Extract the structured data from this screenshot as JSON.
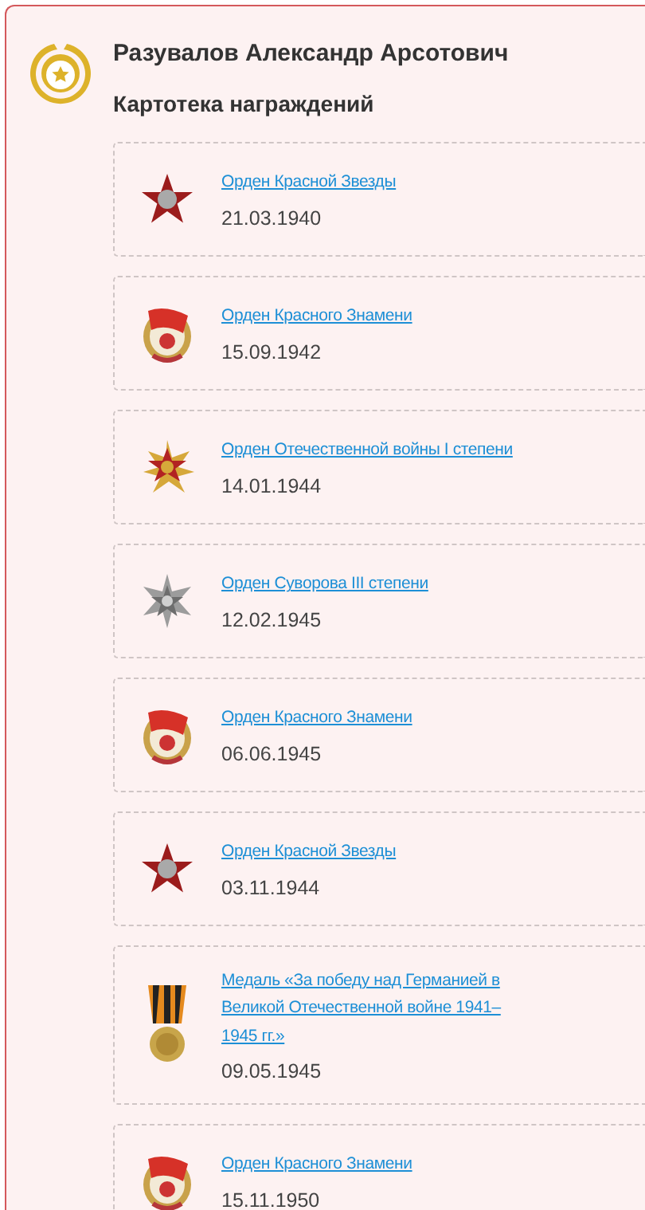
{
  "person": {
    "name": "Разувалов Александр Арсотович",
    "subtitle": "Картотека награждений"
  },
  "awards": [
    {
      "kind": "star",
      "title": "Орден Красной Звезды",
      "date": "21.03.1940"
    },
    {
      "kind": "banner",
      "title": "Орден Красного Знамени",
      "date": "15.09.1942"
    },
    {
      "kind": "patriotic",
      "title": "Орден Отечественной войны I степени",
      "date": "14.01.1944"
    },
    {
      "kind": "suvorov",
      "title": "Орден Суворова III степени",
      "date": "12.02.1945"
    },
    {
      "kind": "banner",
      "title": "Орден Красного Знамени",
      "date": "06.06.1945"
    },
    {
      "kind": "star",
      "title": "Орден Красной Звезды",
      "date": "03.11.1944"
    },
    {
      "kind": "medal",
      "title": "Медаль «За победу над Германией в Великой Отечественной войне 1941–1945 гг.»",
      "date": "09.05.1945"
    },
    {
      "kind": "banner",
      "title": "Орден Красного Знамени",
      "date": "15.11.1950"
    }
  ]
}
